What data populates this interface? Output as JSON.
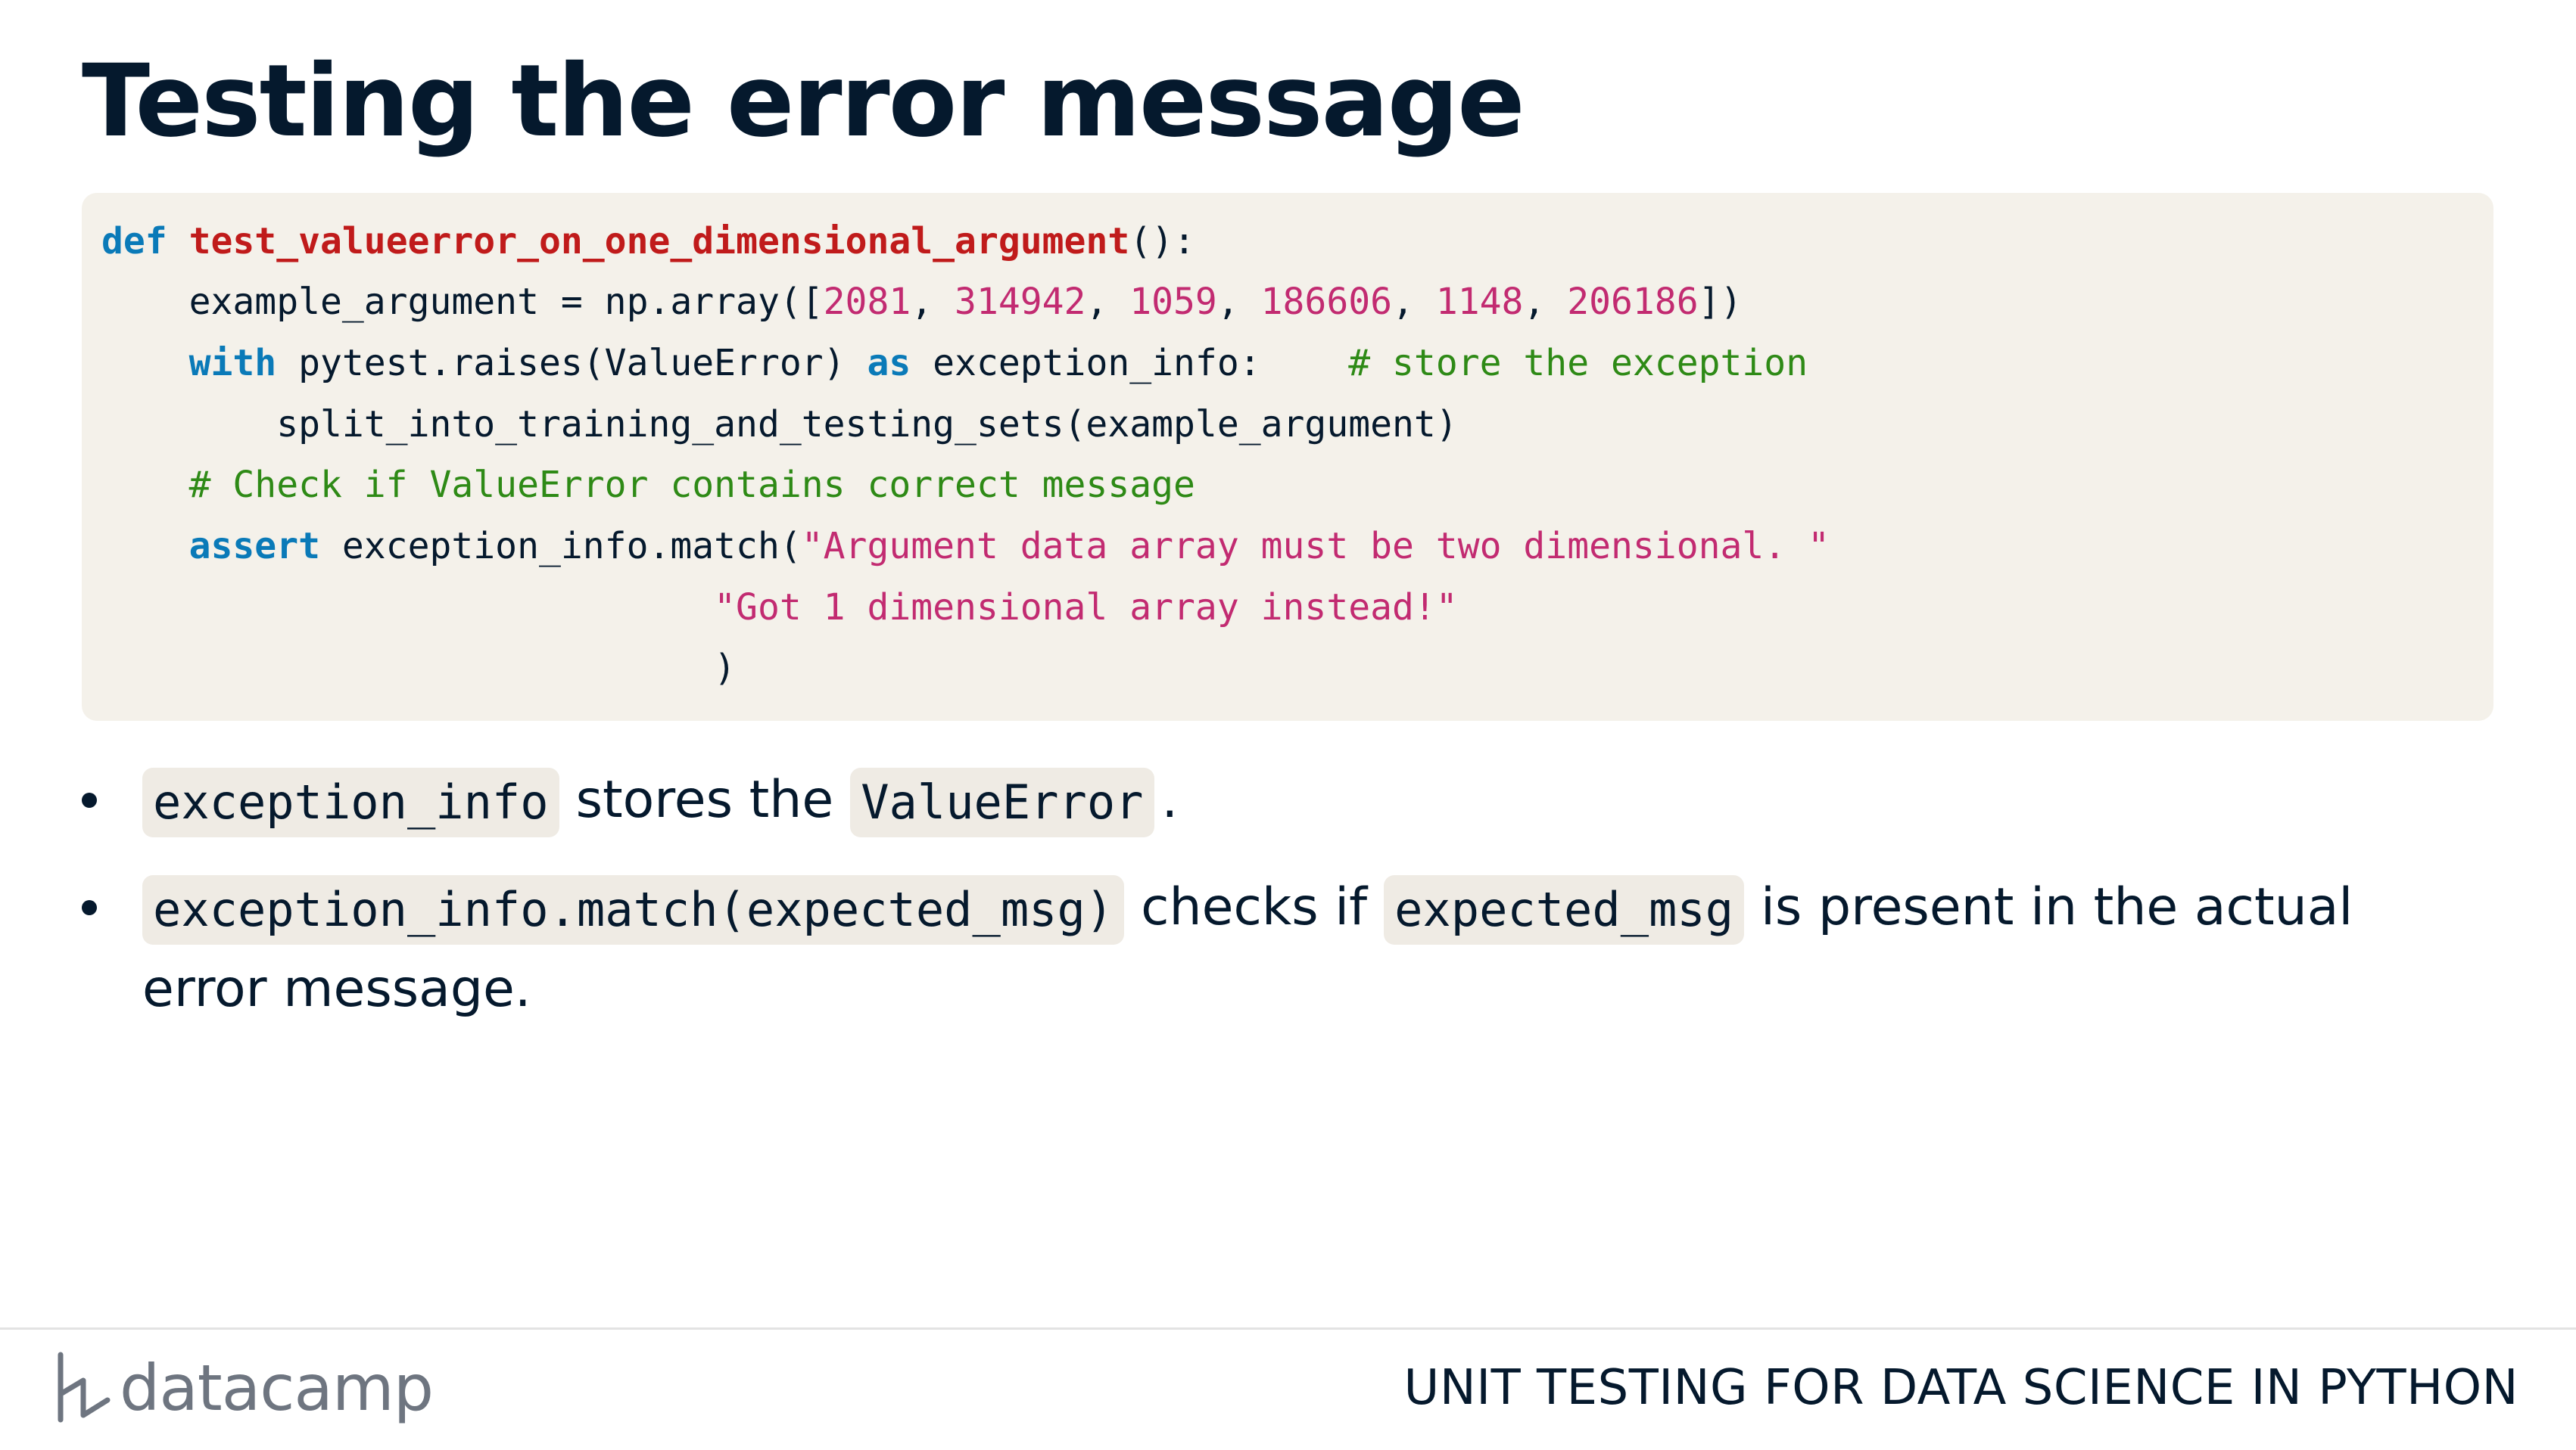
{
  "slide": {
    "title": "Testing the error message"
  },
  "code": {
    "line1": {
      "kw_def": "def",
      "fn_name": "test_valueerror_on_one_dimensional_argument",
      "tail": "():"
    },
    "line2": {
      "indent": "    ",
      "head": "example_argument = np.array([",
      "n1": "2081",
      "sep1": ", ",
      "n2": "314942",
      "sep2": ", ",
      "n3": "1059",
      "sep3": ", ",
      "n4": "186606",
      "sep4": ", ",
      "n5": "1148",
      "sep5": ", ",
      "n6": "206186",
      "tail": "])"
    },
    "line3": {
      "indent": "    ",
      "kw_with": "with",
      "mid1": " pytest.raises(ValueError) ",
      "kw_as": "as",
      "mid2": " exception_info:    ",
      "comment": "# store the exception"
    },
    "line4": {
      "text": "        split_into_training_and_testing_sets(example_argument)"
    },
    "line5": {
      "indent": "    ",
      "comment": "# Check if ValueError contains correct message"
    },
    "line6": {
      "indent": "    ",
      "kw_assert": "assert",
      "mid": " exception_info.match(",
      "str": "\"Argument data array must be two dimensional. \""
    },
    "line7": {
      "indent": "                            ",
      "str": "\"Got 1 dimensional array instead!\""
    },
    "line8": {
      "text": "                            )"
    }
  },
  "bullets": [
    {
      "code1": "exception_info",
      "text1": "stores the",
      "code2": "ValueError",
      "text2": "."
    },
    {
      "code1": "exception_info.match(expected_msg)",
      "text1": "checks if",
      "code2": "expected_msg",
      "text2": "is present in the actual",
      "text3": "error message."
    }
  ],
  "footer": {
    "brand": "datacamp",
    "course_title": "UNIT TESTING FOR DATA SCIENCE IN PYTHON"
  },
  "colors": {
    "text": "#05192d",
    "code_bg": "#f4f1ea",
    "keyword": "#0a7ab8",
    "function": "#c01b1b",
    "string_number": "#c22b71",
    "comment": "#2e8a16",
    "logo": "#6e7580"
  },
  "icons": {
    "logo": "datacamp-logo-icon"
  }
}
